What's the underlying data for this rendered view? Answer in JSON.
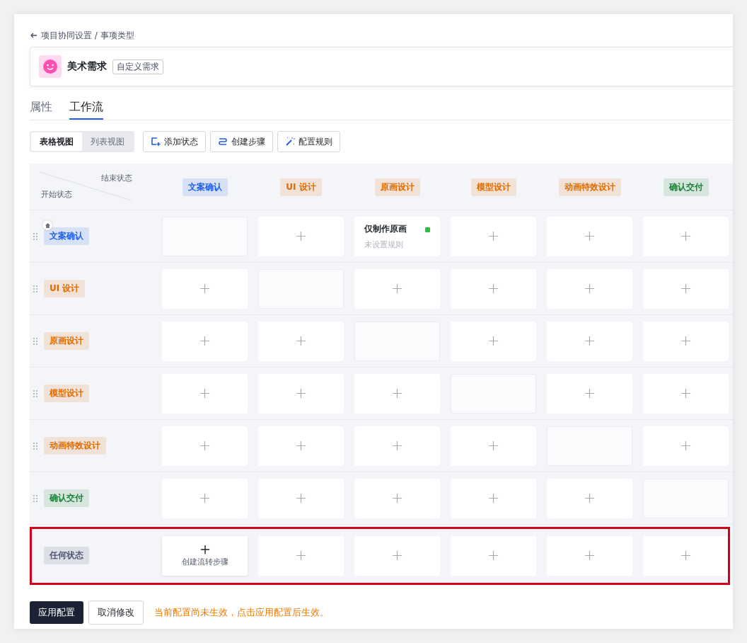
{
  "breadcrumb": {
    "text": "项目协同设置 / 事项类型"
  },
  "header": {
    "title": "美术需求",
    "tag": "自定义需求"
  },
  "tabs": [
    {
      "label": "属性",
      "selected": false
    },
    {
      "label": "工作流",
      "selected": true
    }
  ],
  "view_switch": [
    {
      "label": "表格视图",
      "selected": true
    },
    {
      "label": "列表视图",
      "selected": false
    }
  ],
  "toolbar": [
    {
      "kind": "add-state",
      "label": "添加状态"
    },
    {
      "kind": "create-step",
      "label": "创建步骤"
    },
    {
      "kind": "rules",
      "label": "配置规则"
    }
  ],
  "corner": {
    "end_label": "结束状态",
    "start_label": "开始状态"
  },
  "columns": [
    {
      "label": "文案确认",
      "color": "#1f5ee6"
    },
    {
      "label": "UI 设计",
      "color": "#e06a00"
    },
    {
      "label": "原画设计",
      "color": "#e06a00"
    },
    {
      "label": "模型设计",
      "color": "#e06a00"
    },
    {
      "label": "动画特效设计",
      "color": "#e06a00"
    },
    {
      "label": "确认交付",
      "color": "#1a7f37"
    }
  ],
  "rows": [
    {
      "label": "文案确认",
      "color": "#1f5ee6",
      "initial": true,
      "draggable": true,
      "highlighted": false,
      "cells": [
        {
          "kind": "none"
        },
        {
          "kind": "add"
        },
        {
          "kind": "step",
          "title": "仅制作原画",
          "subtitle": "未设置规则",
          "color": "#2bbf3a"
        },
        {
          "kind": "add"
        },
        {
          "kind": "add"
        },
        {
          "kind": "add"
        }
      ]
    },
    {
      "label": "UI 设计",
      "color": "#e06a00",
      "initial": false,
      "draggable": true,
      "highlighted": false,
      "cells": [
        {
          "kind": "add"
        },
        {
          "kind": "none"
        },
        {
          "kind": "add"
        },
        {
          "kind": "add"
        },
        {
          "kind": "add"
        },
        {
          "kind": "add"
        }
      ]
    },
    {
      "label": "原画设计",
      "color": "#e06a00",
      "initial": false,
      "draggable": true,
      "highlighted": false,
      "cells": [
        {
          "kind": "add"
        },
        {
          "kind": "add"
        },
        {
          "kind": "none"
        },
        {
          "kind": "add"
        },
        {
          "kind": "add"
        },
        {
          "kind": "add"
        }
      ]
    },
    {
      "label": "模型设计",
      "color": "#e06a00",
      "initial": false,
      "draggable": true,
      "highlighted": false,
      "cells": [
        {
          "kind": "add"
        },
        {
          "kind": "add"
        },
        {
          "kind": "add"
        },
        {
          "kind": "none"
        },
        {
          "kind": "add"
        },
        {
          "kind": "add"
        }
      ]
    },
    {
      "label": "动画特效设计",
      "color": "#e06a00",
      "initial": false,
      "draggable": true,
      "highlighted": false,
      "cells": [
        {
          "kind": "add"
        },
        {
          "kind": "add"
        },
        {
          "kind": "add"
        },
        {
          "kind": "add"
        },
        {
          "kind": "none"
        },
        {
          "kind": "add"
        }
      ]
    },
    {
      "label": "确认交付",
      "color": "#1a7f37",
      "initial": false,
      "draggable": true,
      "highlighted": false,
      "cells": [
        {
          "kind": "add"
        },
        {
          "kind": "add"
        },
        {
          "kind": "add"
        },
        {
          "kind": "add"
        },
        {
          "kind": "add"
        },
        {
          "kind": "none"
        }
      ]
    },
    {
      "label": "任何状态",
      "color": "#4a5470",
      "initial": false,
      "draggable": false,
      "highlighted": true,
      "cells": [
        {
          "kind": "create",
          "title": "创建流转步骤"
        },
        {
          "kind": "add"
        },
        {
          "kind": "add"
        },
        {
          "kind": "add"
        },
        {
          "kind": "add"
        },
        {
          "kind": "add"
        }
      ]
    }
  ],
  "footer": {
    "apply": "应用配置",
    "cancel": "取消修改",
    "notice": "当前配置尚未生效，点击应用配置后生效。"
  }
}
